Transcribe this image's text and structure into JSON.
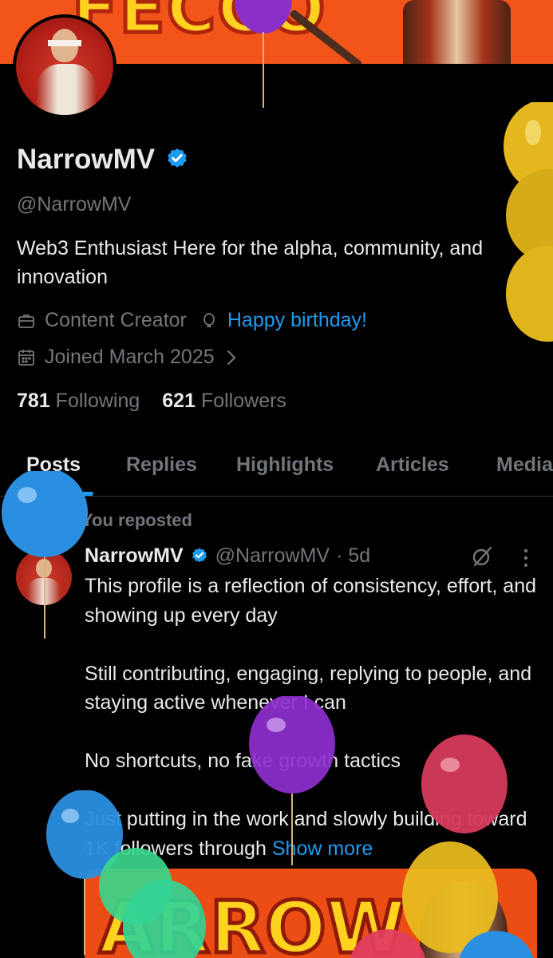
{
  "profile": {
    "display_name": "NarrowMV",
    "handle": "@NarrowMV",
    "bio": "Web3 Enthusiast   Here for the alpha, community, and innovation",
    "category": "Content Creator",
    "birthday": "Happy birthday!",
    "joined": "Joined March 2025",
    "following_count": "781",
    "following_label": "Following",
    "followers_count": "621",
    "followers_label": "Followers"
  },
  "tabs": [
    {
      "label": "Posts",
      "active": true
    },
    {
      "label": "Replies"
    },
    {
      "label": "Highlights"
    },
    {
      "label": "Articles"
    },
    {
      "label": "Media"
    }
  ],
  "post": {
    "repost_label": "You reposted",
    "author_name": "NarrowMV",
    "author_handle": "@NarrowMV",
    "time": "· 5d",
    "paragraphs": [
      "This profile is a reflection of consistency, effort, and showing up every day",
      "Still contributing, engaging, replying to people, and staying active whenever I can",
      "No shortcuts, no fake growth tactics"
    ],
    "last_paragraph": "Just putting in the work and slowly building toward 1K followers through",
    "show_more": "Show more"
  },
  "colors": {
    "accent": "#1d9bf0",
    "background": "#000000",
    "muted": "#71767b",
    "banner": "#f2541a"
  }
}
